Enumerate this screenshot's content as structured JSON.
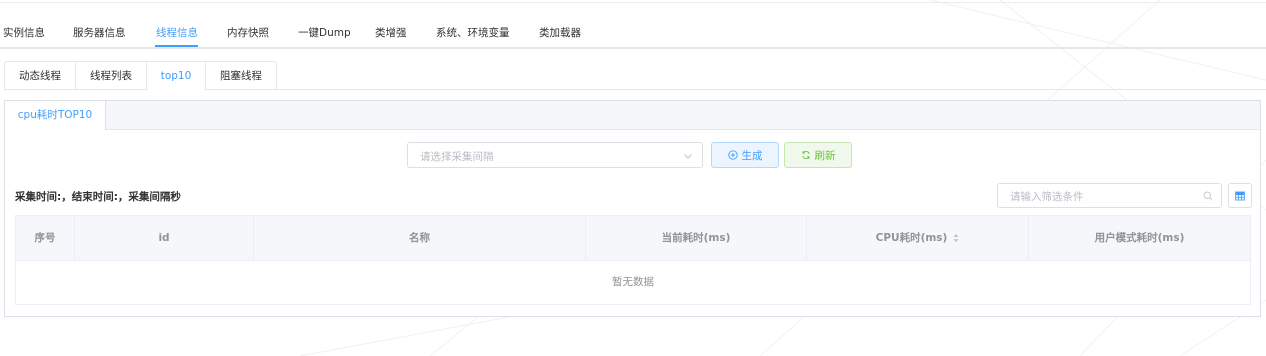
{
  "main_tabs": [
    {
      "label": "实例信息",
      "active": false
    },
    {
      "label": "服务器信息",
      "active": false
    },
    {
      "label": "线程信息",
      "active": true
    },
    {
      "label": "内存快照",
      "active": false
    },
    {
      "label": "一键Dump",
      "active": false
    },
    {
      "label": "类增强",
      "active": false
    },
    {
      "label": "系统、环境变量",
      "active": false
    },
    {
      "label": "类加载器",
      "active": false
    }
  ],
  "sub_tabs": [
    {
      "label": "动态线程",
      "active": false
    },
    {
      "label": "线程列表",
      "active": false
    },
    {
      "label": "top10",
      "active": true
    },
    {
      "label": "阻塞线程",
      "active": false
    }
  ],
  "panel": {
    "tab_label": "cpu耗时TOP10",
    "interval_select": {
      "placeholder": "请选择采集间隔",
      "value": ""
    },
    "generate_label": "生成",
    "refresh_label": "刷新",
    "info_text": "采集时间:，结束时间:，采集间隔秒",
    "filter": {
      "placeholder": "请输入筛选条件",
      "value": ""
    },
    "table": {
      "columns": [
        "序号",
        "id",
        "名称",
        "当前耗时(ms)",
        "CPU耗时(ms)",
        "用户模式耗时(ms)"
      ],
      "rows": [],
      "empty_text": "暂无数据"
    }
  },
  "colors": {
    "primary": "#409eff",
    "success": "#67c23a",
    "border": "#dcdfe6",
    "header_bg": "#f5f7fa"
  }
}
